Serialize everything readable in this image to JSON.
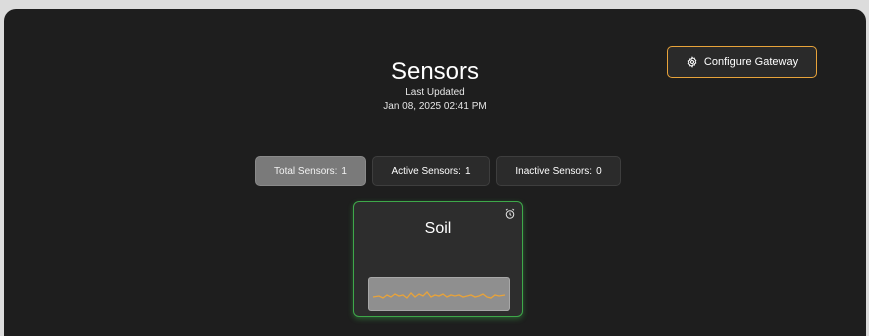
{
  "header": {
    "title": "Sensors",
    "last_updated_label": "Last Updated",
    "last_updated_time": "Jan 08, 2025 02:41 PM"
  },
  "config_button": {
    "label": "Configure Gateway",
    "icon": "gear-icon",
    "border_color": "#e8a33a"
  },
  "filters": [
    {
      "label": "Total Sensors:",
      "count": "1",
      "selected": true
    },
    {
      "label": "Active Sensors:",
      "count": "1",
      "selected": false
    },
    {
      "label": "Inactive Sensors:",
      "count": "0",
      "selected": false
    }
  ],
  "sensors": [
    {
      "name": "Soil",
      "icon": "alarm-clock-icon",
      "status_color": "#3ea84a",
      "sparkline_color": "#e8a33a"
    }
  ]
}
